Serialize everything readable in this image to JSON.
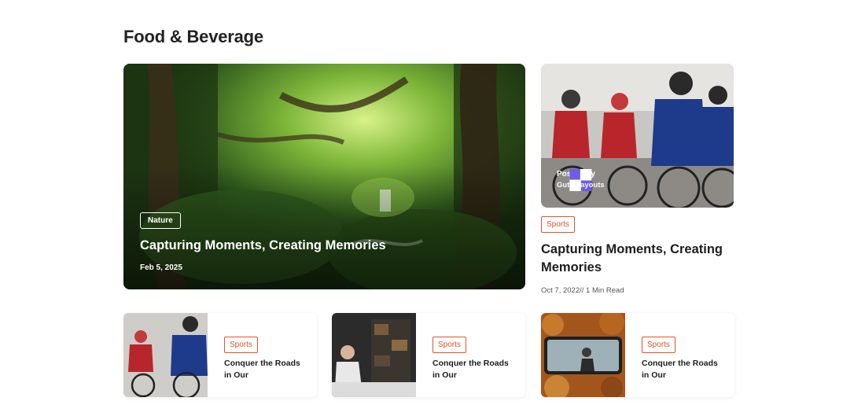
{
  "section": {
    "title": "Food & Beverage"
  },
  "hero": {
    "tag": "Nature",
    "title": "Capturing Moments, Creating Memories",
    "date": "Feb 5, 2025"
  },
  "side": {
    "posted_by_label": "Posted By",
    "author": "Gutenlayouts",
    "tag": "Sports",
    "title": "Capturing Moments, Creating Memories",
    "meta": "Oct 7, 2022// 1 Min Read"
  },
  "cards": [
    {
      "tag": "Sports",
      "title": "Conquer the Roads in Our"
    },
    {
      "tag": "Sports",
      "title": "Conquer the Roads in Our"
    },
    {
      "tag": "Sports",
      "title": "Conquer the Roads in Our"
    }
  ],
  "colors": {
    "accent": "#e2532c",
    "logo": "#6c5ce7"
  }
}
